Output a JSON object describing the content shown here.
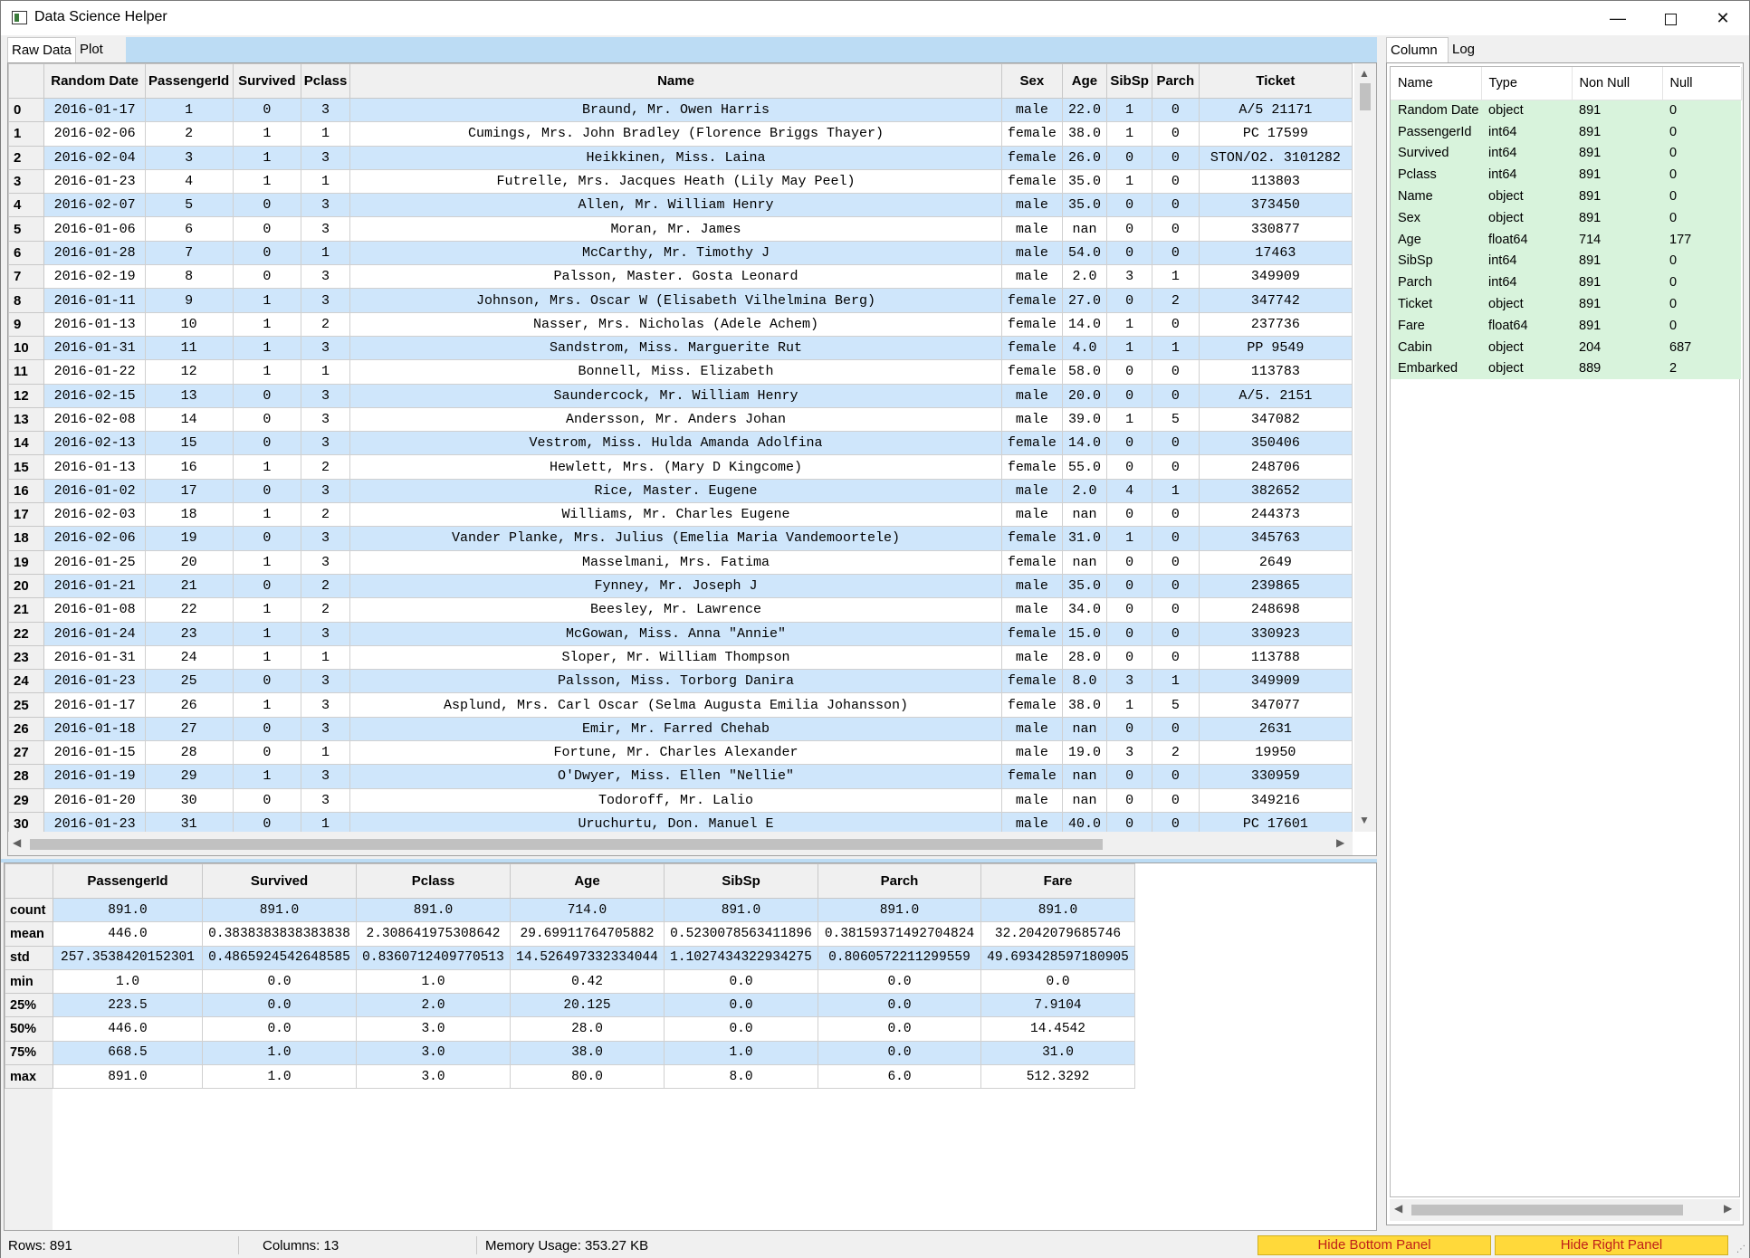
{
  "window": {
    "title": "Data Science Helper",
    "minimize": "—",
    "close": "✕"
  },
  "left_tabs": [
    {
      "label": "Raw Data"
    },
    {
      "label": "Plot"
    }
  ],
  "right_tabs": [
    {
      "label": "Column"
    },
    {
      "label": "Log"
    }
  ],
  "raw_table": {
    "columns": [
      "Random Date",
      "PassengerId",
      "Survived",
      "Pclass",
      "Name",
      "Sex",
      "Age",
      "SibSp",
      "Parch",
      "Ticket"
    ],
    "rows": [
      [
        "0",
        "2016-01-17",
        "1",
        "0",
        "3",
        "Braund, Mr. Owen Harris",
        "male",
        "22.0",
        "1",
        "0",
        "A/5 21171"
      ],
      [
        "1",
        "2016-02-06",
        "2",
        "1",
        "1",
        "Cumings, Mrs. John Bradley (Florence Briggs Thayer)",
        "female",
        "38.0",
        "1",
        "0",
        "PC 17599"
      ],
      [
        "2",
        "2016-02-04",
        "3",
        "1",
        "3",
        "Heikkinen, Miss. Laina",
        "female",
        "26.0",
        "0",
        "0",
        "STON/O2. 3101282"
      ],
      [
        "3",
        "2016-01-23",
        "4",
        "1",
        "1",
        "Futrelle, Mrs. Jacques Heath (Lily May Peel)",
        "female",
        "35.0",
        "1",
        "0",
        "113803"
      ],
      [
        "4",
        "2016-02-07",
        "5",
        "0",
        "3",
        "Allen, Mr. William Henry",
        "male",
        "35.0",
        "0",
        "0",
        "373450"
      ],
      [
        "5",
        "2016-01-06",
        "6",
        "0",
        "3",
        "Moran, Mr. James",
        "male",
        "nan",
        "0",
        "0",
        "330877"
      ],
      [
        "6",
        "2016-01-28",
        "7",
        "0",
        "1",
        "McCarthy, Mr. Timothy J",
        "male",
        "54.0",
        "0",
        "0",
        "17463"
      ],
      [
        "7",
        "2016-02-19",
        "8",
        "0",
        "3",
        "Palsson, Master. Gosta Leonard",
        "male",
        "2.0",
        "3",
        "1",
        "349909"
      ],
      [
        "8",
        "2016-01-11",
        "9",
        "1",
        "3",
        "Johnson, Mrs. Oscar W (Elisabeth Vilhelmina Berg)",
        "female",
        "27.0",
        "0",
        "2",
        "347742"
      ],
      [
        "9",
        "2016-01-13",
        "10",
        "1",
        "2",
        "Nasser, Mrs. Nicholas (Adele Achem)",
        "female",
        "14.0",
        "1",
        "0",
        "237736"
      ],
      [
        "10",
        "2016-01-31",
        "11",
        "1",
        "3",
        "Sandstrom, Miss. Marguerite Rut",
        "female",
        "4.0",
        "1",
        "1",
        "PP 9549"
      ],
      [
        "11",
        "2016-01-22",
        "12",
        "1",
        "1",
        "Bonnell, Miss. Elizabeth",
        "female",
        "58.0",
        "0",
        "0",
        "113783"
      ],
      [
        "12",
        "2016-02-15",
        "13",
        "0",
        "3",
        "Saundercock, Mr. William Henry",
        "male",
        "20.0",
        "0",
        "0",
        "A/5. 2151"
      ],
      [
        "13",
        "2016-02-08",
        "14",
        "0",
        "3",
        "Andersson, Mr. Anders Johan",
        "male",
        "39.0",
        "1",
        "5",
        "347082"
      ],
      [
        "14",
        "2016-02-13",
        "15",
        "0",
        "3",
        "Vestrom, Miss. Hulda Amanda Adolfina",
        "female",
        "14.0",
        "0",
        "0",
        "350406"
      ],
      [
        "15",
        "2016-01-13",
        "16",
        "1",
        "2",
        "Hewlett, Mrs. (Mary D Kingcome)",
        "female",
        "55.0",
        "0",
        "0",
        "248706"
      ],
      [
        "16",
        "2016-01-02",
        "17",
        "0",
        "3",
        "Rice, Master. Eugene",
        "male",
        "2.0",
        "4",
        "1",
        "382652"
      ],
      [
        "17",
        "2016-02-03",
        "18",
        "1",
        "2",
        "Williams, Mr. Charles Eugene",
        "male",
        "nan",
        "0",
        "0",
        "244373"
      ],
      [
        "18",
        "2016-02-06",
        "19",
        "0",
        "3",
        "Vander Planke, Mrs. Julius (Emelia Maria Vandemoortele)",
        "female",
        "31.0",
        "1",
        "0",
        "345763"
      ],
      [
        "19",
        "2016-01-25",
        "20",
        "1",
        "3",
        "Masselmani, Mrs. Fatima",
        "female",
        "nan",
        "0",
        "0",
        "2649"
      ],
      [
        "20",
        "2016-01-21",
        "21",
        "0",
        "2",
        "Fynney, Mr. Joseph J",
        "male",
        "35.0",
        "0",
        "0",
        "239865"
      ],
      [
        "21",
        "2016-01-08",
        "22",
        "1",
        "2",
        "Beesley, Mr. Lawrence",
        "male",
        "34.0",
        "0",
        "0",
        "248698"
      ],
      [
        "22",
        "2016-01-24",
        "23",
        "1",
        "3",
        "McGowan, Miss. Anna \"Annie\"",
        "female",
        "15.0",
        "0",
        "0",
        "330923"
      ],
      [
        "23",
        "2016-01-31",
        "24",
        "1",
        "1",
        "Sloper, Mr. William Thompson",
        "male",
        "28.0",
        "0",
        "0",
        "113788"
      ],
      [
        "24",
        "2016-01-23",
        "25",
        "0",
        "3",
        "Palsson, Miss. Torborg Danira",
        "female",
        "8.0",
        "3",
        "1",
        "349909"
      ],
      [
        "25",
        "2016-01-17",
        "26",
        "1",
        "3",
        "Asplund, Mrs. Carl Oscar (Selma Augusta Emilia Johansson)",
        "female",
        "38.0",
        "1",
        "5",
        "347077"
      ],
      [
        "26",
        "2016-01-18",
        "27",
        "0",
        "3",
        "Emir, Mr. Farred Chehab",
        "male",
        "nan",
        "0",
        "0",
        "2631"
      ],
      [
        "27",
        "2016-01-15",
        "28",
        "0",
        "1",
        "Fortune, Mr. Charles Alexander",
        "male",
        "19.0",
        "3",
        "2",
        "19950"
      ],
      [
        "28",
        "2016-01-19",
        "29",
        "1",
        "3",
        "O'Dwyer, Miss. Ellen \"Nellie\"",
        "female",
        "nan",
        "0",
        "0",
        "330959"
      ],
      [
        "29",
        "2016-01-20",
        "30",
        "0",
        "3",
        "Todoroff, Mr. Lalio",
        "male",
        "nan",
        "0",
        "0",
        "349216"
      ],
      [
        "30",
        "2016-01-23",
        "31",
        "0",
        "1",
        "Uruchurtu, Don. Manuel E",
        "male",
        "40.0",
        "0",
        "0",
        "PC 17601"
      ]
    ]
  },
  "describe_table": {
    "columns": [
      "PassengerId",
      "Survived",
      "Pclass",
      "Age",
      "SibSp",
      "Parch",
      "Fare"
    ],
    "rows": [
      [
        "count",
        "891.0",
        "891.0",
        "891.0",
        "714.0",
        "891.0",
        "891.0",
        "891.0"
      ],
      [
        "mean",
        "446.0",
        "0.3838383838383838",
        "2.308641975308642",
        "29.69911764705882",
        "0.5230078563411896",
        "0.38159371492704824",
        "32.2042079685746"
      ],
      [
        "std",
        "257.3538420152301",
        "0.4865924542648585",
        "0.8360712409770513",
        "14.526497332334044",
        "1.1027434322934275",
        "0.8060572211299559",
        "49.693428597180905"
      ],
      [
        "min",
        "1.0",
        "0.0",
        "1.0",
        "0.42",
        "0.0",
        "0.0",
        "0.0"
      ],
      [
        "25%",
        "223.5",
        "0.0",
        "2.0",
        "20.125",
        "0.0",
        "0.0",
        "7.9104"
      ],
      [
        "50%",
        "446.0",
        "0.0",
        "3.0",
        "28.0",
        "0.0",
        "0.0",
        "14.4542"
      ],
      [
        "75%",
        "668.5",
        "1.0",
        "3.0",
        "38.0",
        "1.0",
        "0.0",
        "31.0"
      ],
      [
        "max",
        "891.0",
        "1.0",
        "3.0",
        "80.0",
        "8.0",
        "6.0",
        "512.3292"
      ]
    ]
  },
  "column_info": {
    "headers": [
      "Name",
      "Type",
      "Non Null",
      "Null"
    ],
    "rows": [
      [
        "Random Date",
        "object",
        "891",
        "0"
      ],
      [
        "PassengerId",
        "int64",
        "891",
        "0"
      ],
      [
        "Survived",
        "int64",
        "891",
        "0"
      ],
      [
        "Pclass",
        "int64",
        "891",
        "0"
      ],
      [
        "Name",
        "object",
        "891",
        "0"
      ],
      [
        "Sex",
        "object",
        "891",
        "0"
      ],
      [
        "Age",
        "float64",
        "714",
        "177"
      ],
      [
        "SibSp",
        "int64",
        "891",
        "0"
      ],
      [
        "Parch",
        "int64",
        "891",
        "0"
      ],
      [
        "Ticket",
        "object",
        "891",
        "0"
      ],
      [
        "Fare",
        "float64",
        "891",
        "0"
      ],
      [
        "Cabin",
        "object",
        "204",
        "687"
      ],
      [
        "Embarked",
        "object",
        "889",
        "2"
      ]
    ]
  },
  "status": {
    "rows": "Rows: 891",
    "columns": "Columns: 13",
    "memory": "Memory Usage: 353.27 KB",
    "hide_bottom": "Hide Bottom Panel",
    "hide_right": "Hide Right Panel"
  },
  "colors": {
    "row_alt": "#cfe6fb",
    "tabbar": "#bcdcf4",
    "column_rows": "#d8f3dc",
    "button_bg": "#ffd93a",
    "button_text": "#c0201a"
  },
  "icons": {
    "app": "app-window-icon",
    "scroll_up": "scroll-up-arrow-icon",
    "scroll_down": "scroll-down-arrow-icon"
  }
}
